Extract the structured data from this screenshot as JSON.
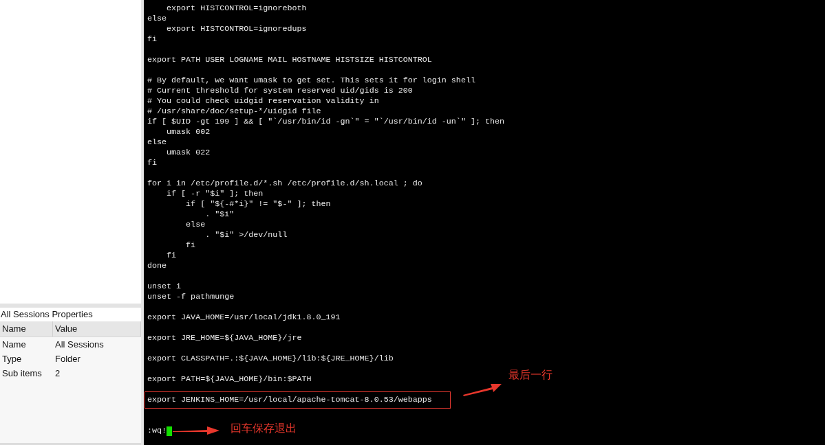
{
  "properties_panel": {
    "title": "All Sessions Properties",
    "columns": [
      "Name",
      "Value"
    ],
    "rows": [
      [
        "Name",
        "All Sessions"
      ],
      [
        "Type",
        "Folder"
      ],
      [
        "Sub items",
        "2"
      ]
    ]
  },
  "terminal": {
    "lines": [
      {
        "kind": "code",
        "text": "    export HISTCONTROL=ignoreboth",
        "boxed": false
      },
      {
        "kind": "code",
        "text": "else",
        "boxed": false
      },
      {
        "kind": "code",
        "text": "    export HISTCONTROL=ignoredups",
        "boxed": false
      },
      {
        "kind": "code",
        "text": "fi",
        "boxed": false
      },
      {
        "kind": "blank"
      },
      {
        "kind": "code",
        "text": "export PATH USER LOGNAME MAIL HOSTNAME HISTSIZE HISTCONTROL",
        "boxed": false
      },
      {
        "kind": "blank"
      },
      {
        "kind": "code",
        "text": "# By default, we want umask to get set. This sets it for login shell",
        "boxed": false
      },
      {
        "kind": "code",
        "text": "# Current threshold for system reserved uid/gids is 200",
        "boxed": false
      },
      {
        "kind": "code",
        "text": "# You could check uidgid reservation validity in",
        "boxed": false
      },
      {
        "kind": "code",
        "text": "# /usr/share/doc/setup-*/uidgid file",
        "boxed": false
      },
      {
        "kind": "code",
        "text": "if [ $UID -gt 199 ] && [ \"`/usr/bin/id -gn`\" = \"`/usr/bin/id -un`\" ]; then",
        "boxed": false
      },
      {
        "kind": "code",
        "text": "    umask 002",
        "boxed": false
      },
      {
        "kind": "code",
        "text": "else",
        "boxed": false
      },
      {
        "kind": "code",
        "text": "    umask 022",
        "boxed": false
      },
      {
        "kind": "code",
        "text": "fi",
        "boxed": false
      },
      {
        "kind": "blank"
      },
      {
        "kind": "code",
        "text": "for i in /etc/profile.d/*.sh /etc/profile.d/sh.local ; do",
        "boxed": false
      },
      {
        "kind": "code",
        "text": "    if [ -r \"$i\" ]; then",
        "boxed": false
      },
      {
        "kind": "code",
        "text": "        if [ \"${-#*i}\" != \"$-\" ]; then",
        "boxed": false
      },
      {
        "kind": "code",
        "text": "            . \"$i\"",
        "boxed": false
      },
      {
        "kind": "code",
        "text": "        else",
        "boxed": false
      },
      {
        "kind": "code",
        "text": "            . \"$i\" >/dev/null",
        "boxed": false
      },
      {
        "kind": "code",
        "text": "        fi",
        "boxed": false
      },
      {
        "kind": "code",
        "text": "    fi",
        "boxed": false
      },
      {
        "kind": "code",
        "text": "done",
        "boxed": false
      },
      {
        "kind": "blank"
      },
      {
        "kind": "code",
        "text": "unset i",
        "boxed": false
      },
      {
        "kind": "code",
        "text": "unset -f pathmunge",
        "boxed": false
      },
      {
        "kind": "blank"
      },
      {
        "kind": "code",
        "text": "export JAVA_HOME=/usr/local/jdk1.8.0_191",
        "boxed": false
      },
      {
        "kind": "blank"
      },
      {
        "kind": "code",
        "text": "export JRE_HOME=${JAVA_HOME}/jre",
        "boxed": false
      },
      {
        "kind": "blank"
      },
      {
        "kind": "code",
        "text": "export CLASSPATH=.:${JAVA_HOME}/lib:${JRE_HOME}/lib",
        "boxed": false
      },
      {
        "kind": "blank"
      },
      {
        "kind": "code",
        "text": "export PATH=${JAVA_HOME}/bin:$PATH",
        "boxed": false
      },
      {
        "kind": "blank"
      },
      {
        "kind": "code",
        "text": "export JENKINS_HOME=/usr/local/apache-tomcat-8.0.53/webapps",
        "boxed": true
      },
      {
        "kind": "blank"
      },
      {
        "kind": "blank"
      }
    ],
    "command_line": {
      "text": ":wq!",
      "cursor": true
    }
  },
  "annotations": [
    {
      "text": "最后一行"
    },
    {
      "text": "回车保存退出"
    }
  ]
}
